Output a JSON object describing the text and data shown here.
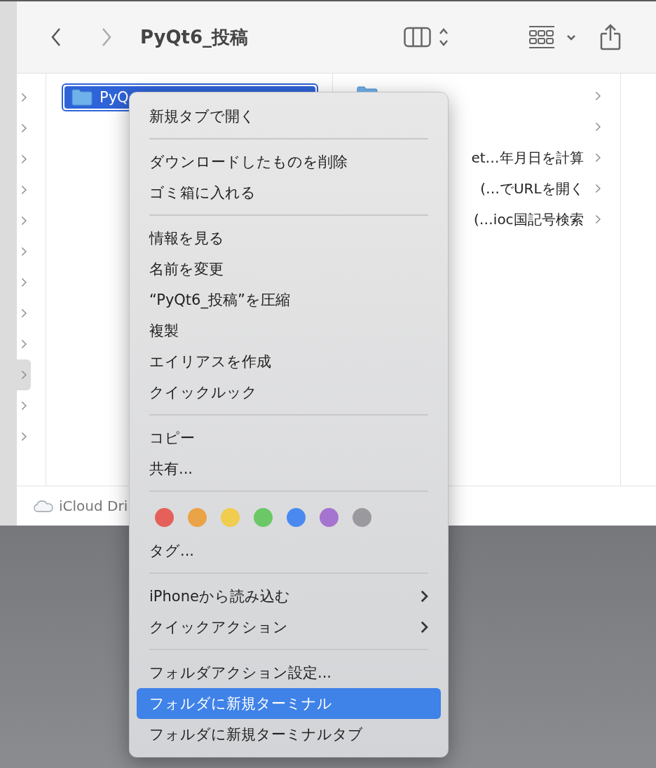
{
  "toolbar": {
    "title": "PyQt6_投稿",
    "back_enabled": true,
    "forward_enabled": false
  },
  "column_1": {
    "rows": [
      {
        "selected": false
      },
      {
        "selected": false
      },
      {
        "selected": false
      },
      {
        "selected": false
      },
      {
        "selected": false
      },
      {
        "selected": false
      },
      {
        "selected": false
      },
      {
        "selected": false
      },
      {
        "selected": false
      },
      {
        "selected": true
      },
      {
        "selected": false
      },
      {
        "selected": false
      }
    ]
  },
  "column_2": {
    "rows": [
      {
        "name": "PyQ",
        "selected": true
      }
    ]
  },
  "column_3": {
    "rows": [
      {
        "kind": "folder"
      },
      {
        "kind": "blank"
      },
      {
        "kind": "named",
        "name": "et…年月日を計算"
      },
      {
        "kind": "named",
        "name": "(…でURLを開く"
      },
      {
        "kind": "named",
        "name": "(…ioc国記号検索"
      }
    ]
  },
  "path_bar": {
    "label": "iCloud Dri"
  },
  "context_menu": {
    "items": [
      {
        "kind": "item",
        "label": "新規タブで開く",
        "selected": false,
        "submenu": false
      },
      {
        "kind": "separator"
      },
      {
        "kind": "item",
        "label": "ダウンロードしたものを削除",
        "selected": false,
        "submenu": false
      },
      {
        "kind": "item",
        "label": "ゴミ箱に入れる",
        "selected": false,
        "submenu": false
      },
      {
        "kind": "separator"
      },
      {
        "kind": "item",
        "label": "情報を見る",
        "selected": false,
        "submenu": false
      },
      {
        "kind": "item",
        "label": "名前を変更",
        "selected": false,
        "submenu": false
      },
      {
        "kind": "item",
        "label": "“PyQt6_投稿”を圧縮",
        "selected": false,
        "submenu": false
      },
      {
        "kind": "item",
        "label": "複製",
        "selected": false,
        "submenu": false
      },
      {
        "kind": "item",
        "label": "エイリアスを作成",
        "selected": false,
        "submenu": false
      },
      {
        "kind": "item",
        "label": "クイックルック",
        "selected": false,
        "submenu": false
      },
      {
        "kind": "separator"
      },
      {
        "kind": "item",
        "label": "コピー",
        "selected": false,
        "submenu": false
      },
      {
        "kind": "item",
        "label": "共有...",
        "selected": false,
        "submenu": false
      },
      {
        "kind": "separator"
      },
      {
        "kind": "tags",
        "tags": [
          {
            "color": "#e5605a"
          },
          {
            "color": "#eba347"
          },
          {
            "color": "#f0cc4f"
          },
          {
            "color": "#6cc866"
          },
          {
            "color": "#4a8af0"
          },
          {
            "color": "#a574d0"
          },
          {
            "color": "#9a9a9e"
          }
        ]
      },
      {
        "kind": "item",
        "label": "タグ...",
        "selected": false,
        "submenu": false
      },
      {
        "kind": "separator"
      },
      {
        "kind": "item",
        "label": "iPhoneから読み込む",
        "selected": false,
        "submenu": true
      },
      {
        "kind": "item",
        "label": "クイックアクション",
        "selected": false,
        "submenu": true
      },
      {
        "kind": "separator"
      },
      {
        "kind": "item",
        "label": "フォルダアクション設定...",
        "selected": false,
        "submenu": false
      },
      {
        "kind": "item",
        "label": "フォルダに新規ターミナル",
        "selected": true,
        "submenu": false
      },
      {
        "kind": "item",
        "label": "フォルダに新規ターミナルタブ",
        "selected": false,
        "submenu": false
      }
    ]
  }
}
